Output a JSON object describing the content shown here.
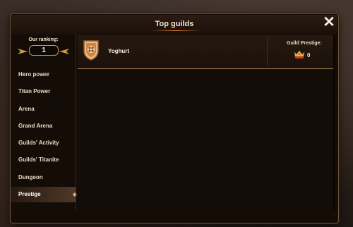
{
  "window": {
    "title": "Top guilds",
    "close_icon": "close-icon"
  },
  "ranking": {
    "label": "Our ranking:",
    "value": "1"
  },
  "sidebar": {
    "items": [
      {
        "label": "Hero power",
        "active": false
      },
      {
        "label": "Titan Power",
        "active": false
      },
      {
        "label": "Arena",
        "active": false
      },
      {
        "label": "Grand Arena",
        "active": false
      },
      {
        "label": "Guilds' Activity",
        "active": false
      },
      {
        "label": "Guilds' Titanite",
        "active": false
      },
      {
        "label": "Dungeon",
        "active": false
      },
      {
        "label": "Prestige",
        "active": true
      }
    ]
  },
  "guilds": [
    {
      "name": "Yoghurt",
      "emblem_icon": "guild-shield-emblem-icon",
      "prestige_label": "Guild Prestige:",
      "prestige_icon": "prestige-crown-icon",
      "prestige_value": "0"
    }
  ],
  "colors": {
    "accent_gold": "#c99b45",
    "title_glow": "#e0782c",
    "panel_bg": "#140c07"
  }
}
